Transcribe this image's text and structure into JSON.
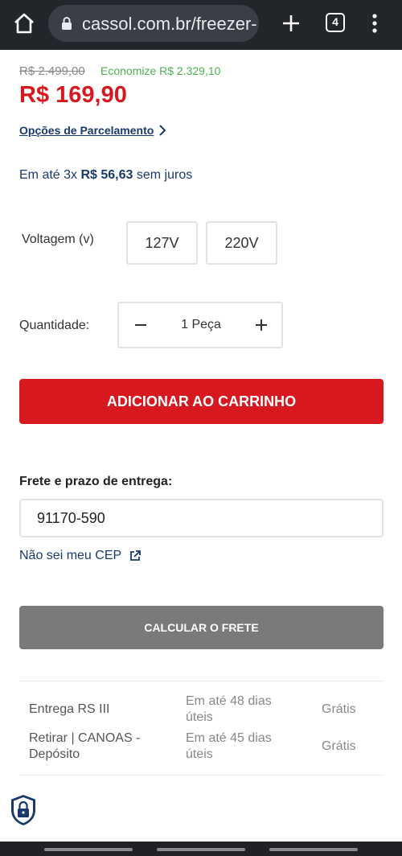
{
  "browser": {
    "url": "cassol.com.br/freezer-",
    "tab_count": "4"
  },
  "product": {
    "old_price": "R$ 2.499,00",
    "savings": "Economize R$ 2.329,10",
    "price": "R$ 169,90",
    "installment_options_link": "Opções de Parcelamento",
    "installment_prefix": "Em até 3x",
    "installment_value": "R$ 56,63",
    "installment_suffix": "sem juros"
  },
  "voltage": {
    "label": "Voltagem (v)",
    "options": [
      "127V",
      "220V"
    ]
  },
  "quantity": {
    "label": "Quantidade:",
    "value": "1 Peça"
  },
  "cart": {
    "add_label": "ADICIONAR AO CARRINHO"
  },
  "shipping": {
    "title": "Frete e prazo de entrega:",
    "cep_value": "91170-590",
    "unknown_cep_link": "Não sei meu CEP",
    "calculate_label": "CALCULAR O FRETE",
    "results": [
      {
        "name": "Entrega RS III",
        "time": "Em até 48 dias úteis",
        "price": "Grátis"
      },
      {
        "name": "Retirar | CANOAS - Depósito",
        "time": "Em até 45 dias úteis",
        "price": "Grátis"
      }
    ]
  },
  "colors": {
    "brand_red": "#d7191f",
    "link_navy": "#1a3a6b",
    "savings_green": "#4caf50",
    "disabled_gray": "#7a7a7a"
  }
}
